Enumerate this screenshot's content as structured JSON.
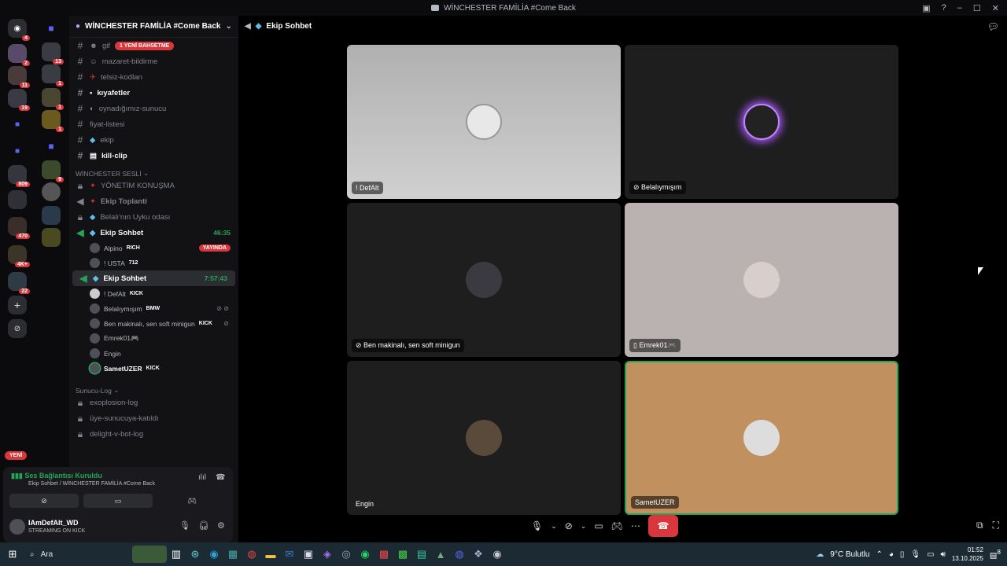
{
  "titlebar": {
    "title": "WİNCHESTER FAMİLİA #Come Back"
  },
  "guild_badges": [
    "4",
    "2",
    "11",
    "19",
    "809",
    "470",
    "4K+",
    "22"
  ],
  "folder_badges": [
    "13",
    "1",
    "1",
    "1",
    "9"
  ],
  "server": {
    "name": "WİNCHESTER FAMİLİA #Come Back"
  },
  "text_channels": [
    {
      "name": "gif",
      "tag": "1 YENİ BAHSETME"
    },
    {
      "name": "mazaret-bildirme"
    },
    {
      "name": "telsiz-kodları"
    },
    {
      "name": "kıyafetler"
    },
    {
      "name": "oynadığımız-sunucu"
    },
    {
      "name": "fiyat-listesi"
    },
    {
      "name": "ekip"
    },
    {
      "name": "kill-clip"
    }
  ],
  "voice_category": "WİNCHESTER SESLİ",
  "voice_channels": [
    {
      "name": "YÖNETİM KONUŞMA"
    },
    {
      "name": "Ekip Toplanti"
    },
    {
      "name": "Belalı'nın Uyku odası"
    },
    {
      "name": "Ekip Sohbet",
      "timer": "46:35"
    }
  ],
  "voice1_users": [
    {
      "name": "Alpino",
      "tag": "RICH",
      "live": "YAYINDA"
    },
    {
      "name": "! USTA",
      "tag": "712"
    }
  ],
  "active_voice": {
    "name": "Ekip Sohbet",
    "timer": "7:57:43"
  },
  "voice2_users": [
    {
      "name": "! DefAlt",
      "tag": "KICK"
    },
    {
      "name": "Belalıymışım",
      "tag": "BMW"
    },
    {
      "name": "Ben makinalı, sen soft minigun",
      "tag": "KICK"
    },
    {
      "name": "Emrek01🎮"
    },
    {
      "name": "Engin"
    },
    {
      "name": "SametUZER",
      "tag": "KICK"
    }
  ],
  "log_category": "Sunucu-Log",
  "log_channels": [
    {
      "name": "exoplosion-log"
    },
    {
      "name": "üye-sunucuya-katıldı"
    },
    {
      "name": "delight-v-bot-log"
    }
  ],
  "new_pill": "YENİ",
  "voice_panel": {
    "status": "Ses Bağlantısı Kuruldu",
    "sub": "Ekip Sohbet / WİNCHESTER FAMİLİA #Come Back"
  },
  "user": {
    "name": "IAmDefAlt_WD",
    "status": "STREAMING ON KICK"
  },
  "main": {
    "channel": "Ekip Sohbet"
  },
  "tiles": [
    {
      "label": "! DefAlt"
    },
    {
      "label": "Belalıymışım"
    },
    {
      "label": "Ben makinalı, sen soft minigun"
    },
    {
      "label": "Emrek01🎮"
    },
    {
      "label": "Engin"
    },
    {
      "label": "SametUZER"
    }
  ],
  "taskbar": {
    "search": "Ara",
    "weather": "9°C Bulutlu",
    "time": "01:52",
    "date": "13.10.2025",
    "notif": "8"
  }
}
